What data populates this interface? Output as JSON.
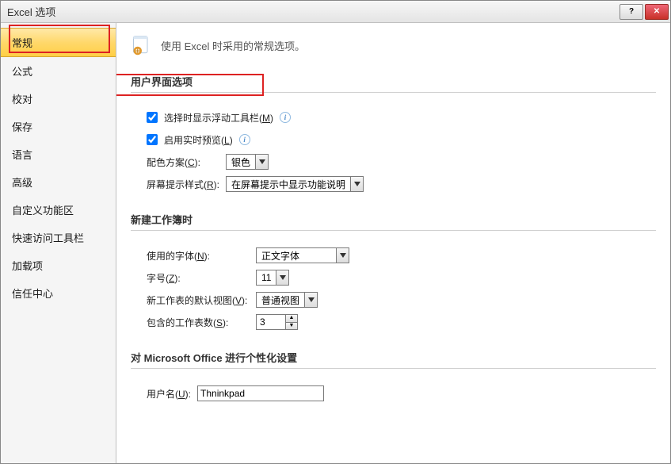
{
  "window": {
    "title": "Excel 选项"
  },
  "sidebar": {
    "items": [
      {
        "label": "常规",
        "selected": true
      },
      {
        "label": "公式"
      },
      {
        "label": "校对"
      },
      {
        "label": "保存"
      },
      {
        "label": "语言"
      },
      {
        "label": "高级"
      },
      {
        "label": "自定义功能区"
      },
      {
        "label": "快速访问工具栏"
      },
      {
        "label": "加载项"
      },
      {
        "label": "信任中心"
      }
    ]
  },
  "header": {
    "text": "使用 Excel 时采用的常规选项。"
  },
  "sections": {
    "ui": {
      "title": "用户界面选项",
      "show_mini_toolbar": {
        "label_pre": "选择时显示浮动工具栏(",
        "hotkey": "M",
        "label_post": ")",
        "checked": true
      },
      "live_preview": {
        "label_pre": "启用实时预览(",
        "hotkey": "L",
        "label_post": ")",
        "checked": true
      },
      "color_scheme": {
        "label_pre": "配色方案(",
        "hotkey": "C",
        "label_post": "):",
        "value": "银色"
      },
      "screentip": {
        "label_pre": "屏幕提示样式(",
        "hotkey": "R",
        "label_post": "):",
        "value": "在屏幕提示中显示功能说明"
      }
    },
    "newwb": {
      "title": "新建工作簿时",
      "font": {
        "label_pre": "使用的字体(",
        "hotkey": "N",
        "label_post": "):",
        "value": "正文字体"
      },
      "size": {
        "label_pre": "字号(",
        "hotkey": "Z",
        "label_post": "):",
        "value": "11"
      },
      "view": {
        "label_pre": "新工作表的默认视图(",
        "hotkey": "V",
        "label_post": "):",
        "value": "普通视图"
      },
      "sheets": {
        "label_pre": "包含的工作表数(",
        "hotkey": "S",
        "label_post": "):",
        "value": "3"
      }
    },
    "personalize": {
      "title": "对 Microsoft Office 进行个性化设置",
      "username": {
        "label_pre": "用户名(",
        "hotkey": "U",
        "label_post": "):",
        "value": "Thninkpad"
      }
    }
  }
}
